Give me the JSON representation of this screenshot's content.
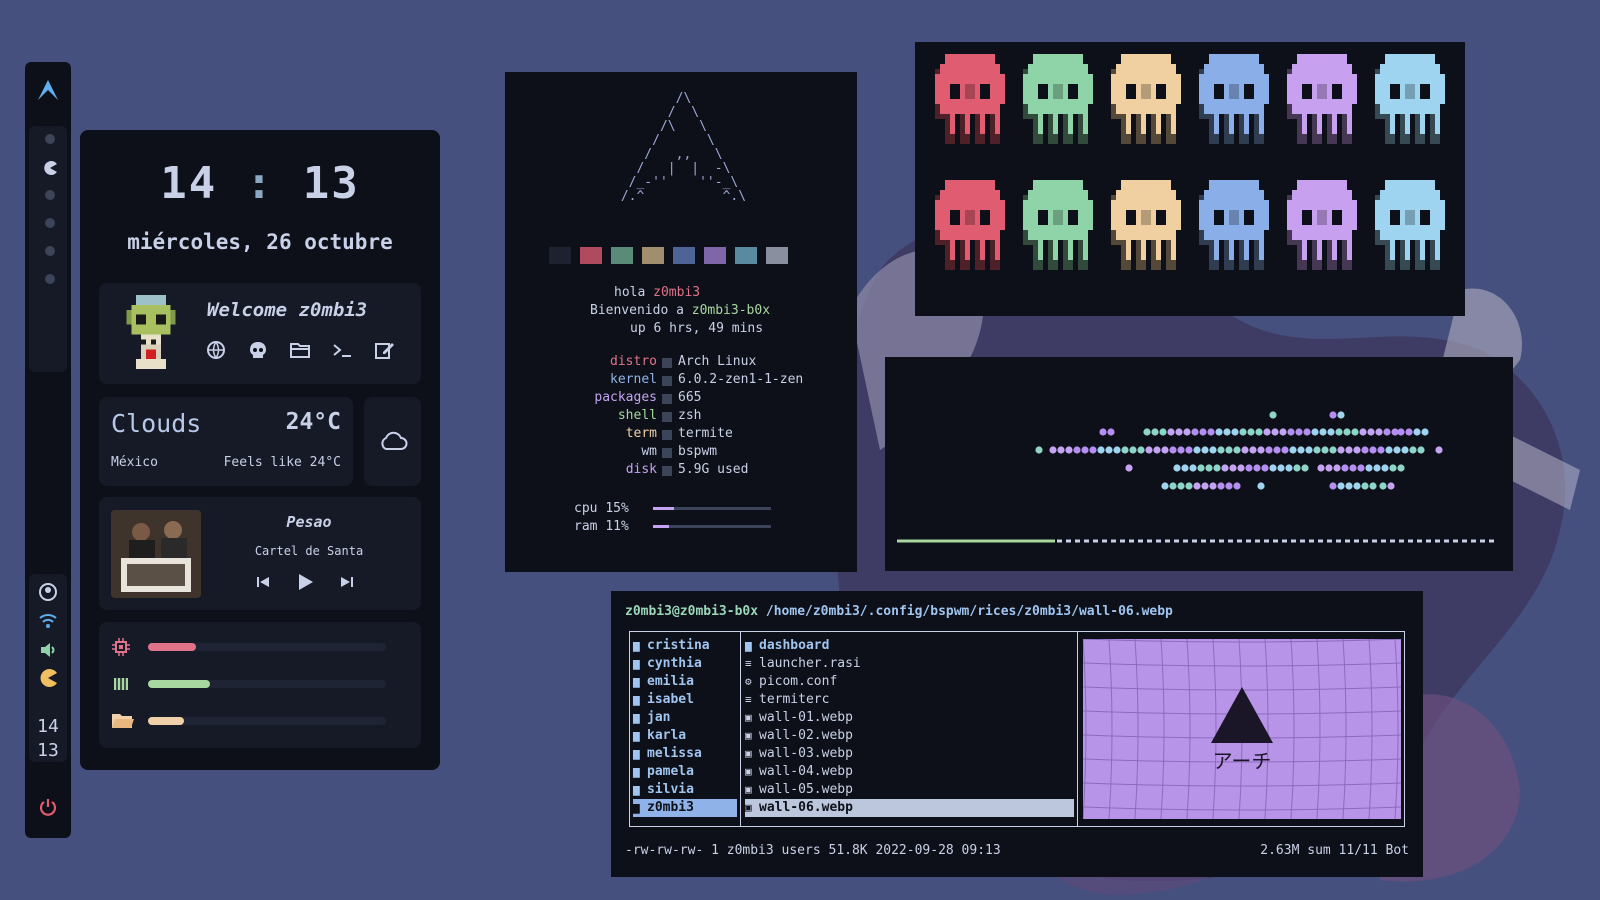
{
  "clock": {
    "hours": "14",
    "minutes": "13",
    "date": "miércoles, 26 octubre"
  },
  "bar": {
    "clock_hours": "14",
    "clock_minutes": "13"
  },
  "profile": {
    "welcome": "Welcome z0mbi3",
    "icons": [
      "globe-icon",
      "skull-icon",
      "folder-icon",
      "terminal-icon",
      "edit-icon"
    ]
  },
  "weather": {
    "condition": "Clouds",
    "temp": "24°C",
    "location": "México",
    "feels_like": "Feels like 24°C"
  },
  "music": {
    "title": "Pesao",
    "artist": "Cartel de Santa"
  },
  "resources": {
    "cpu": 0.2,
    "ram": 0.26,
    "disk": 0.15,
    "colors": {
      "cpu": "#e0738a",
      "ram": "#a8d8a0",
      "disk": "#f0d0a8"
    }
  },
  "neofetch": {
    "ascii": "        /\\\n       /  \\\n      /\\   \\\n     /      \\\n    /   ,,   \\\n   /   |  |  -\\\n  /_-''    ''-_\\\n /.^          ^.\\",
    "hola": "hola",
    "user": "z0mbi3",
    "bienvenido": "Bienvenido a",
    "host": "z0mbi3-b0x",
    "uptime": "up 6 hrs, 49 mins",
    "info": [
      {
        "key": "distro",
        "value": "Arch Linux",
        "color": "#e0738a"
      },
      {
        "key": "kernel",
        "value": "6.0.2-zen1-1-zen",
        "color": "#8fb3e8"
      },
      {
        "key": "packages",
        "value": "665",
        "color": "#c5a3f3"
      },
      {
        "key": "shell",
        "value": "zsh",
        "color": "#a8d8a0"
      },
      {
        "key": "term",
        "value": "termite",
        "color": "#f0d0a8"
      },
      {
        "key": "wm",
        "value": "bspwm",
        "color": "#c9d1e8"
      },
      {
        "key": "disk",
        "value": "5.9G used",
        "color": "#c5a3f3"
      }
    ],
    "cpu_label": "cpu",
    "cpu_value": "15%",
    "cpu_fraction": 0.15,
    "ram_label": "ram",
    "ram_value": "11%",
    "ram_fraction": 0.11,
    "swatches": [
      "#1e2230",
      "#b04a5e",
      "#5a8a78",
      "#a08e6e",
      "#4e6496",
      "#7e66a8",
      "#5a8aa0",
      "#8a8fa0"
    ]
  },
  "skull_colors": [
    "#e05c70",
    "#8fd4a8",
    "#f0d0a0",
    "#8aaee8",
    "#c8a0f0",
    "#9ed4f0"
  ],
  "ranger": {
    "user_host": "z0mbi3@z0mbi3-b0x",
    "path": "/home/z0mbi3/.config/bspwm/rices/z0mbi3/wall-06.webp",
    "rices": [
      "cristina",
      "cynthia",
      "emilia",
      "isabel",
      "jan",
      "karla",
      "melissa",
      "pamela",
      "silvia",
      "z0mbi3"
    ],
    "files": [
      {
        "name": "dashboard",
        "kind": "dir"
      },
      {
        "name": "launcher.rasi",
        "kind": "text"
      },
      {
        "name": "picom.conf",
        "kind": "config"
      },
      {
        "name": "termiterc",
        "kind": "text"
      },
      {
        "name": "wall-01.webp",
        "kind": "image"
      },
      {
        "name": "wall-02.webp",
        "kind": "image"
      },
      {
        "name": "wall-03.webp",
        "kind": "image"
      },
      {
        "name": "wall-04.webp",
        "kind": "image"
      },
      {
        "name": "wall-05.webp",
        "kind": "image"
      },
      {
        "name": "wall-06.webp",
        "kind": "image"
      }
    ],
    "preview_text": "アーチ",
    "status_left": "-rw-rw-rw- 1 z0mbi3 users 51.8K 2022-09-28 09:13",
    "status_right": "2.63M sum   11/11   Bot"
  }
}
